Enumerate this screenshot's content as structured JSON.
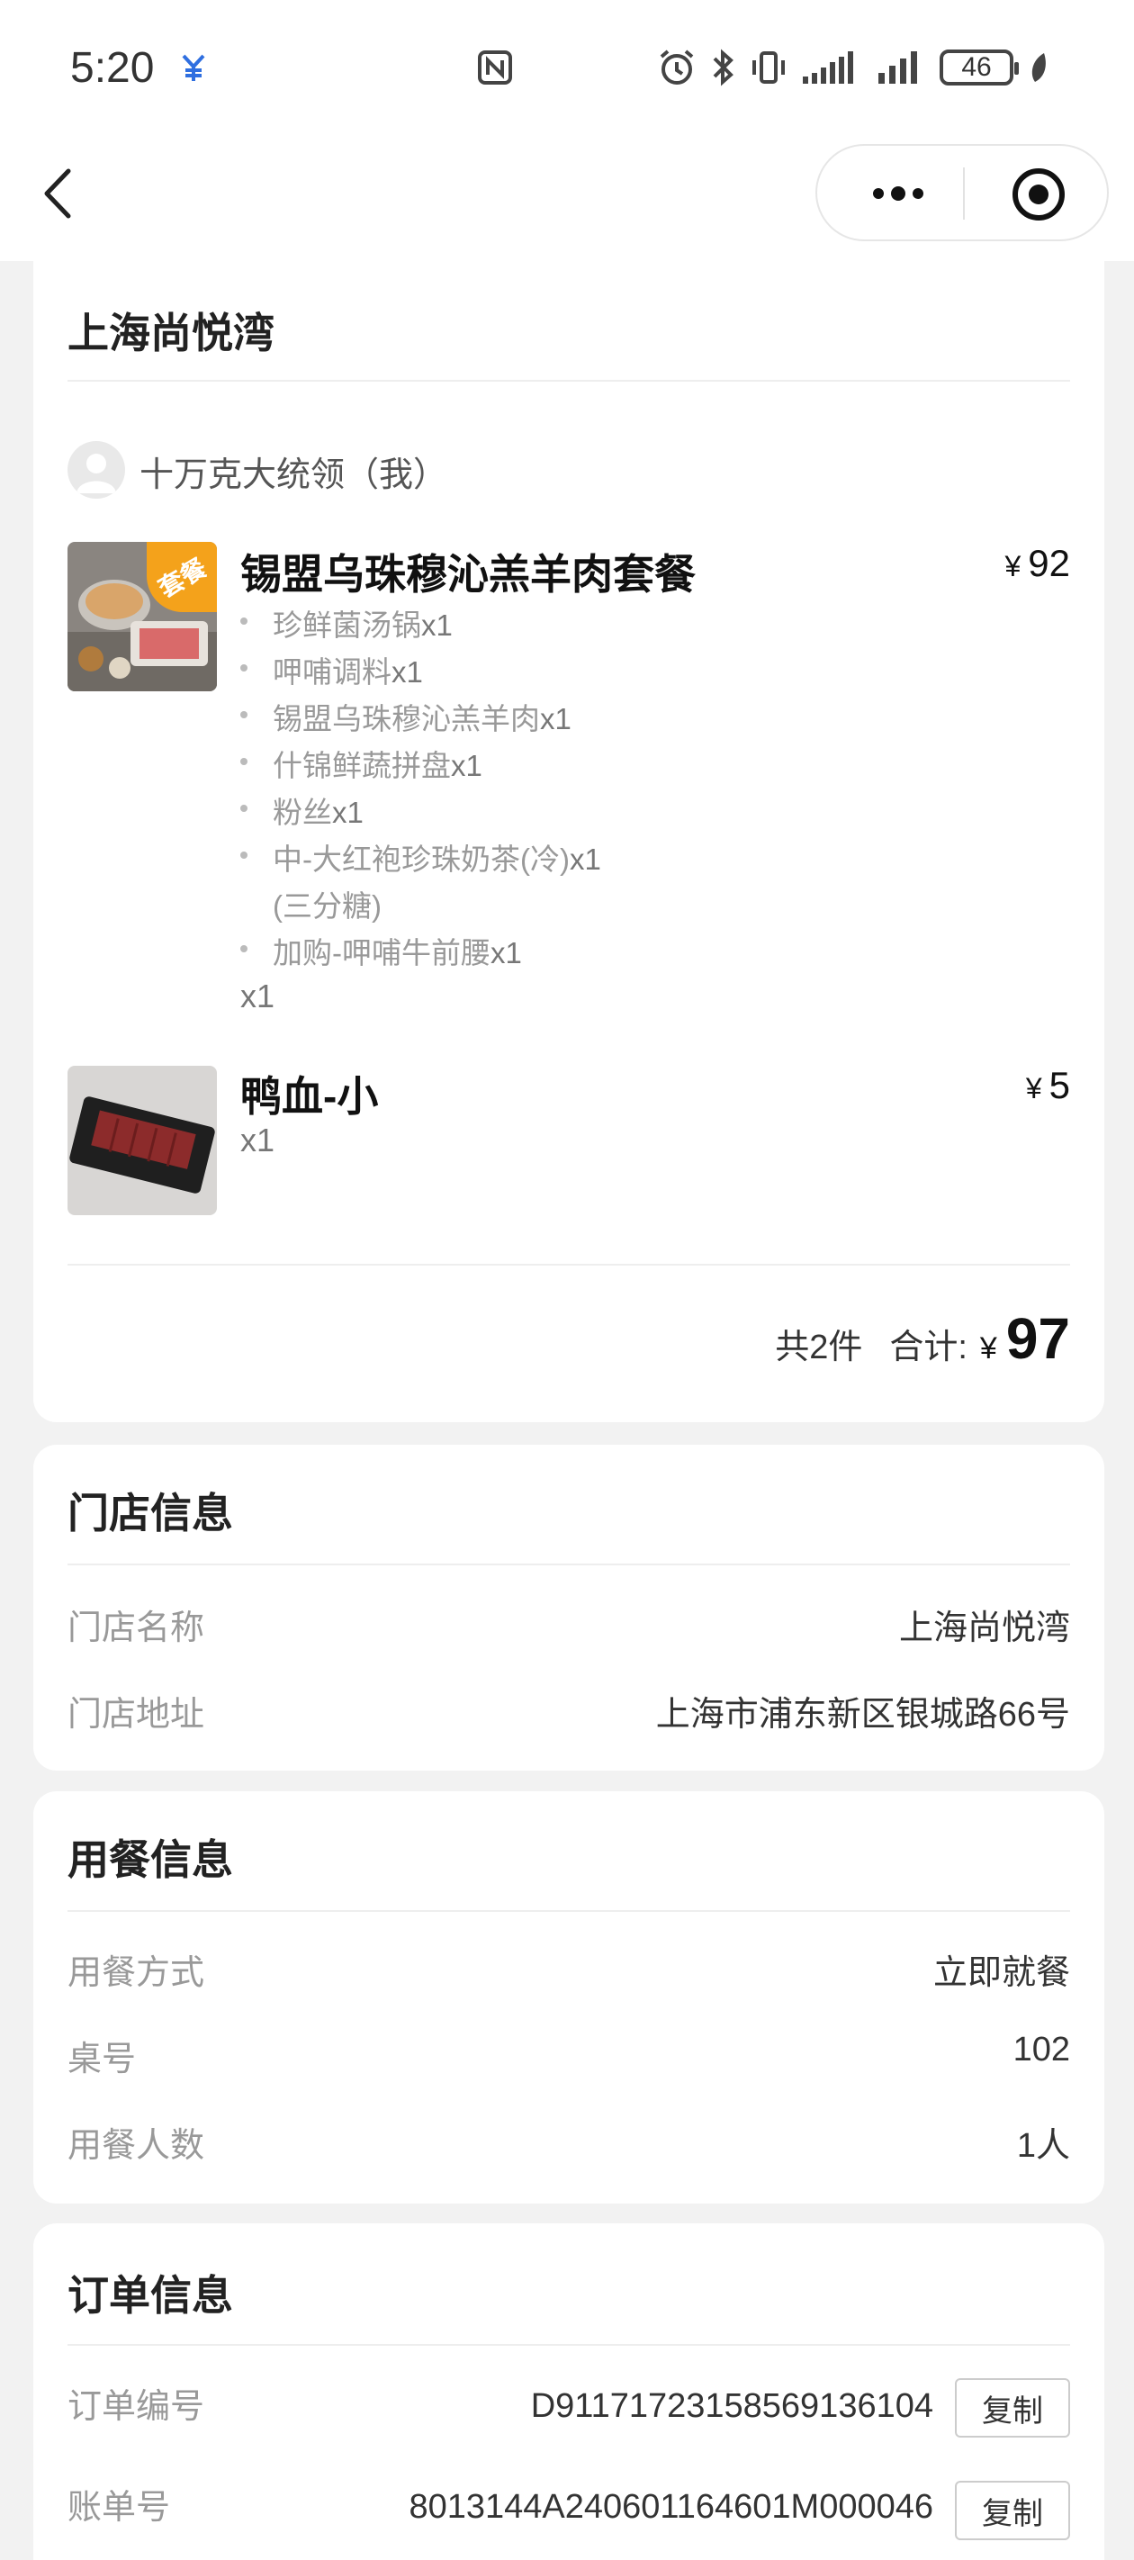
{
  "status_bar": {
    "time": "5:20",
    "battery": "46",
    "icons": [
      "carrier-icon",
      "nfc-icon",
      "alarm-icon",
      "bluetooth-icon",
      "vibrate-icon",
      "signal-icon",
      "signal-icon",
      "battery-icon",
      "leaf-icon"
    ]
  },
  "nav": {
    "back_icon": "chevron-left-icon",
    "more_icon": "more-dots-icon",
    "close_icon": "target-close-icon"
  },
  "order": {
    "store_title": "上海尚悦湾",
    "user": "十万克大统领（我）",
    "items": [
      {
        "name": "锡盟乌珠穆沁羔羊肉套餐",
        "badge": "套餐",
        "price": "92",
        "sub_items": [
          {
            "name": "珍鲜菌汤锅",
            "qty": "x1"
          },
          {
            "name": "呷哺调料",
            "qty": "x1"
          },
          {
            "name": "锡盟乌珠穆沁羔羊肉",
            "qty": "x1"
          },
          {
            "name": "什锦鲜蔬拼盘",
            "qty": "x1"
          },
          {
            "name": "粉丝",
            "qty": "x1"
          },
          {
            "name": "中-大红袍珍珠奶茶(冷)",
            "qty": "x1",
            "note": "(三分糖)"
          },
          {
            "name": "加购-呷哺牛前腰",
            "qty": "x1"
          }
        ],
        "qty": "x1"
      },
      {
        "name": "鸭血-小",
        "price": "5",
        "qty": "x1"
      }
    ],
    "currency": "¥",
    "total_count": "共2件",
    "total_label": "合计:",
    "total": "97"
  },
  "store_info": {
    "title": "门店信息",
    "rows": [
      {
        "label": "门店名称",
        "value": "上海尚悦湾"
      },
      {
        "label": "门店地址",
        "value": "上海市浦东新区银城路66号"
      }
    ]
  },
  "dining_info": {
    "title": "用餐信息",
    "rows": [
      {
        "label": "用餐方式",
        "value": "立即就餐"
      },
      {
        "label": "桌号",
        "value": "102"
      },
      {
        "label": "用餐人数",
        "value": "1人"
      }
    ]
  },
  "order_info": {
    "title": "订单信息",
    "rows": [
      {
        "label": "订单编号",
        "value": "D91171723158569136104",
        "button": "复制"
      },
      {
        "label": "账单号",
        "value": "8013144A240601164601M000046",
        "button": "复制"
      }
    ]
  }
}
